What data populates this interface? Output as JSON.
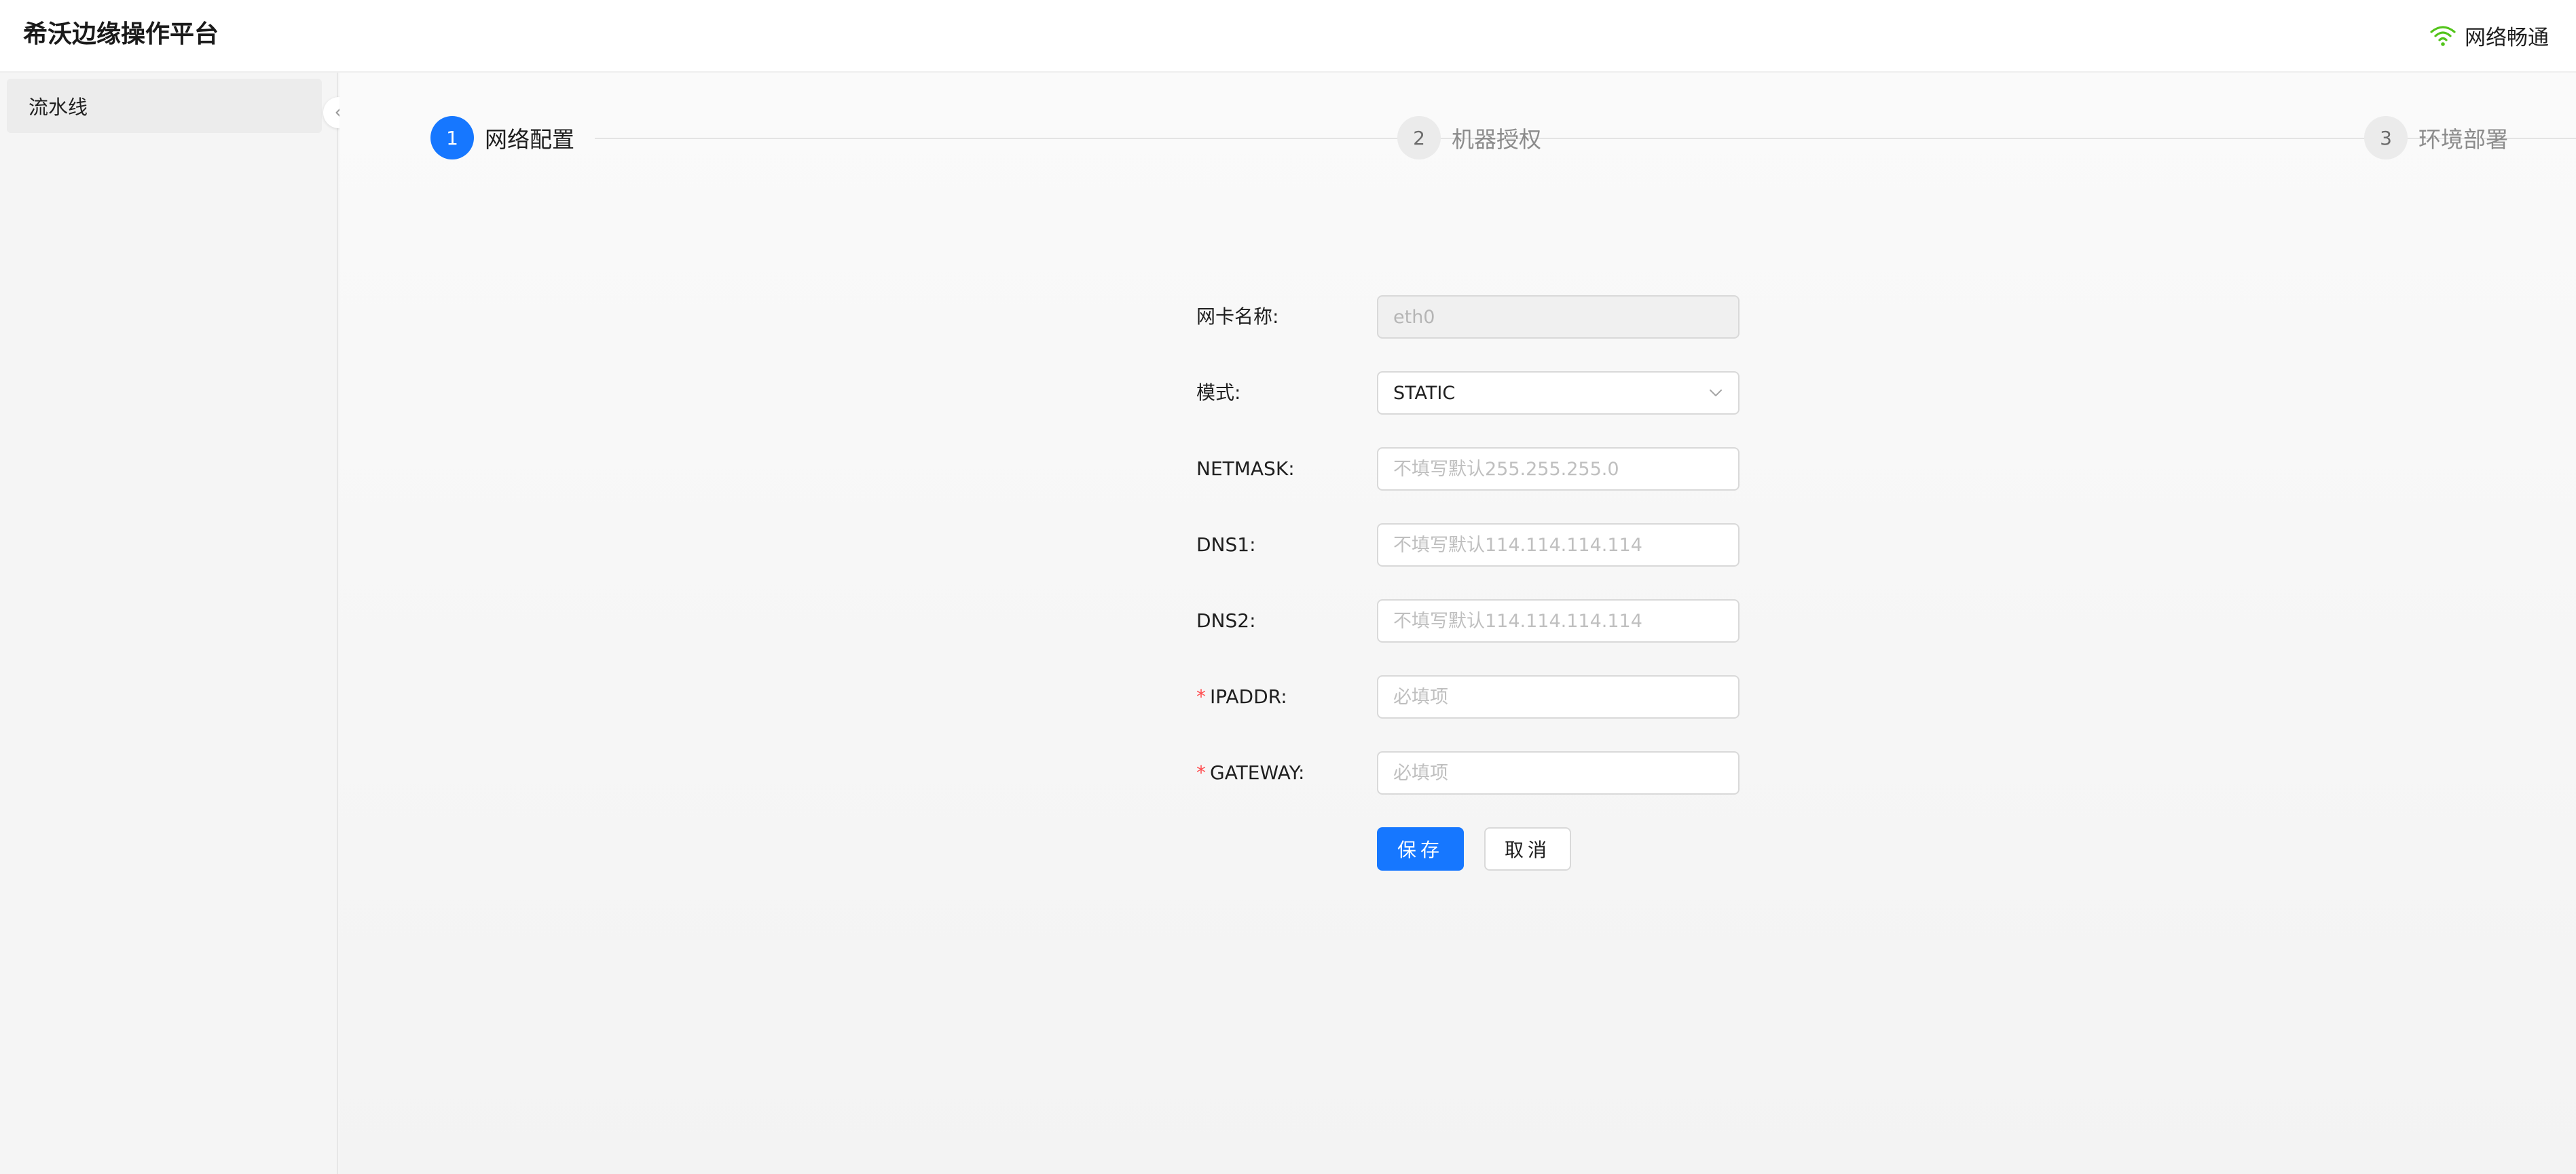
{
  "app": {
    "title": "希沃边缘操作平台",
    "network_status": "网络畅通",
    "network_icon": "wifi-icon",
    "network_icon_color": "#52c41a"
  },
  "sidebar": {
    "items": [
      {
        "label": "流水线",
        "selected": true
      }
    ],
    "collapse_icon": "chevron-left-icon"
  },
  "steps": [
    {
      "number": "1",
      "label": "网络配置",
      "status": "active"
    },
    {
      "number": "2",
      "label": "机器授权",
      "status": "wait"
    },
    {
      "number": "3",
      "label": "环境部署",
      "status": "wait"
    }
  ],
  "form": {
    "nic_name": {
      "label": "网卡名称:",
      "value": "eth0",
      "disabled": true
    },
    "mode": {
      "label": "模式:",
      "value": "STATIC"
    },
    "netmask": {
      "label": "NETMASK:",
      "placeholder": "不填写默认255.255.255.0"
    },
    "dns1": {
      "label": "DNS1:",
      "placeholder": "不填写默认114.114.114.114"
    },
    "dns2": {
      "label": "DNS2:",
      "placeholder": "不填写默认114.114.114.114"
    },
    "ipaddr": {
      "required_mark": "*",
      "label": "IPADDR:",
      "placeholder": "必填项"
    },
    "gateway": {
      "required_mark": "*",
      "label": "GATEWAY:",
      "placeholder": "必填项"
    },
    "save_label": "保存",
    "cancel_label": "取消"
  },
  "colors": {
    "primary": "#1677ff",
    "required": "#ff4d4f"
  }
}
